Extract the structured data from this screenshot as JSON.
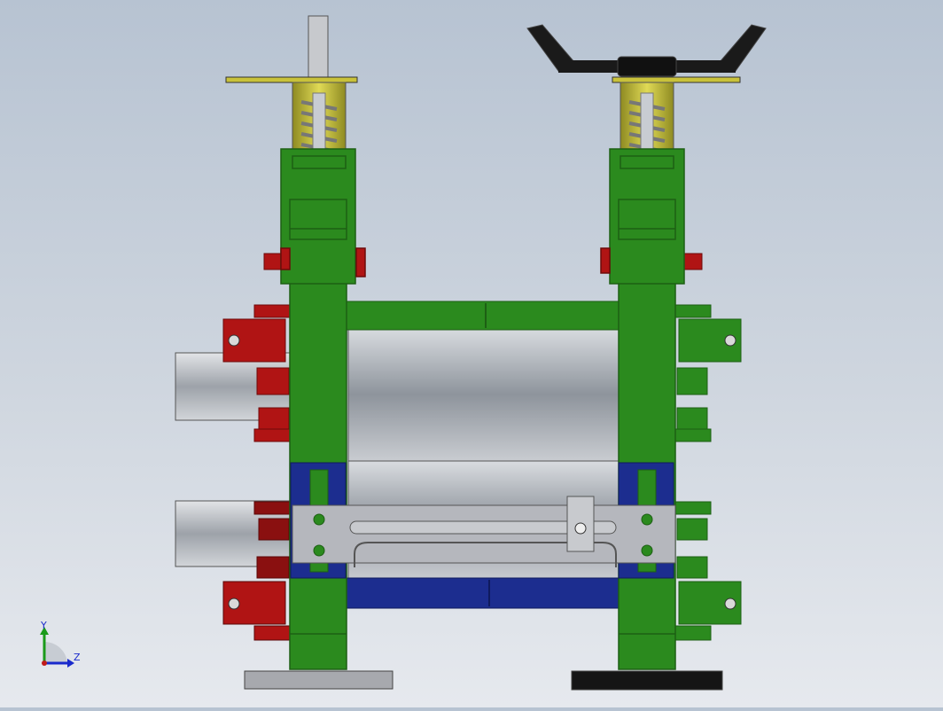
{
  "triad": {
    "y_label": "Y",
    "z_label": "Z"
  },
  "colors": {
    "frame_green": "#2b8a1e",
    "frame_green_dark": "#1d5f14",
    "chock_red": "#b01414",
    "chock_red_dark": "#7a0c0c",
    "spring_yellow": "#c9c23a",
    "roll_blue": "#1c2d8f",
    "plate_gray": "#b5b7bd",
    "roll_steel": "#9aa0a8",
    "handwheel_black": "#1a1a1a",
    "triad_green": "#1a9a1a",
    "triad_blue": "#1a2acc"
  },
  "icons": {
    "left_adjuster": "square-shaft-icon",
    "right_adjuster": "handwheel-icon",
    "triad": "axis-triad-icon"
  }
}
